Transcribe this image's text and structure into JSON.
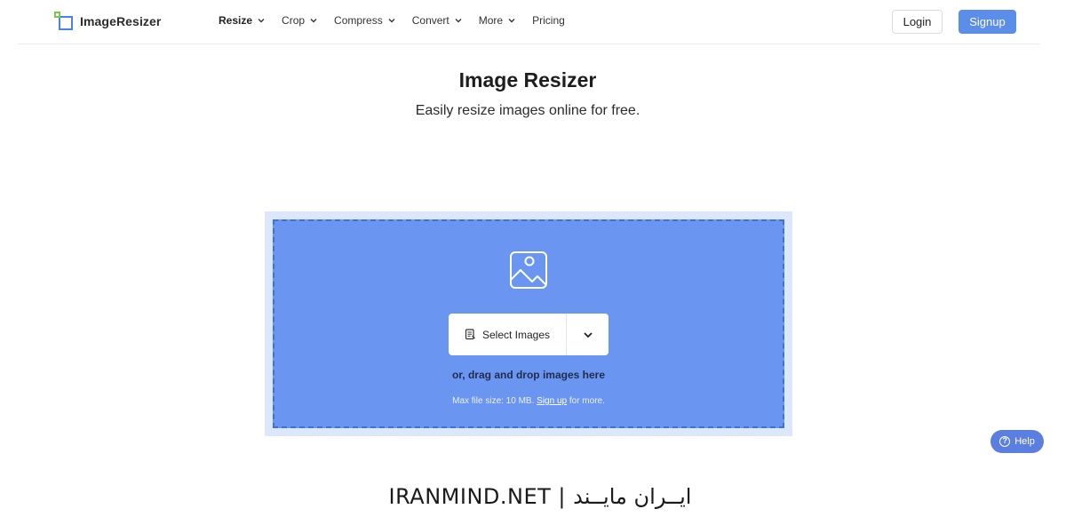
{
  "app": {
    "name": "ImageResizer"
  },
  "nav": {
    "items": [
      {
        "label": "Resize",
        "has_dropdown": true,
        "active": true
      },
      {
        "label": "Crop",
        "has_dropdown": true,
        "active": false
      },
      {
        "label": "Compress",
        "has_dropdown": true,
        "active": false
      },
      {
        "label": "Convert",
        "has_dropdown": true,
        "active": false
      },
      {
        "label": "More",
        "has_dropdown": true,
        "active": false
      },
      {
        "label": "Pricing",
        "has_dropdown": false,
        "active": false
      }
    ]
  },
  "auth": {
    "login_label": "Login",
    "signup_label": "Signup"
  },
  "hero": {
    "title": "Image Resizer",
    "subtitle": "Easily resize images online for free."
  },
  "upload": {
    "select_label": "Select Images",
    "drag_text": "or, drag and drop images here",
    "max_prefix": "Max file size: 10 MB.",
    "signup_link": "Sign up",
    "max_suffix": "for more."
  },
  "help": {
    "label": "Help"
  },
  "watermark": {
    "text": "IRANMIND.NET | ایــران مایــند"
  },
  "colors": {
    "accent": "#5a8ee8",
    "upload_zone": "#6a96f2",
    "upload_border": "#3f72d9",
    "upload_outer": "#dce7fb",
    "logo_blue": "#4a80f0",
    "logo_green": "#7ac943"
  },
  "icons": {
    "logo": "logo-squares-icon",
    "upload": "image-icon",
    "select": "file-icon",
    "dropdown": "chevron-down-icon",
    "help": "question-circle-icon"
  }
}
